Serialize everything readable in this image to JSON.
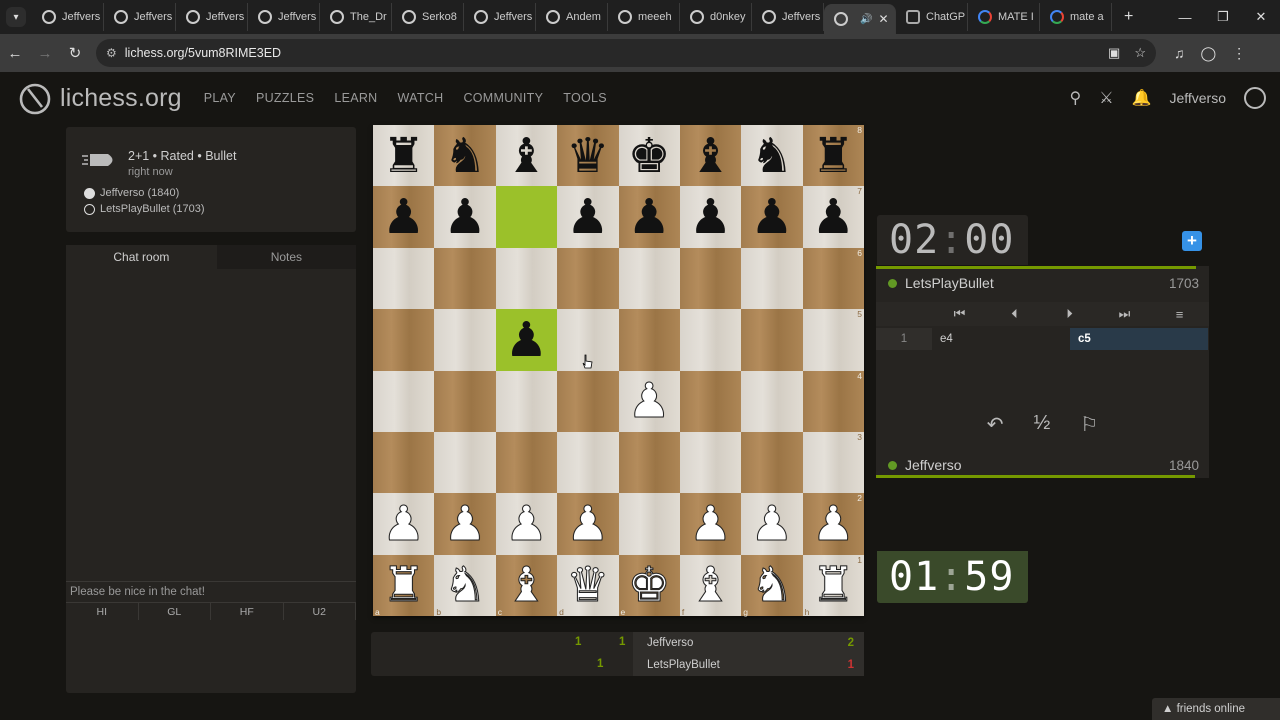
{
  "browser": {
    "tabs": [
      {
        "label": "Jeffvers",
        "icon": "lichess"
      },
      {
        "label": "Jeffvers",
        "icon": "lichess"
      },
      {
        "label": "Jeffvers",
        "icon": "lichess"
      },
      {
        "label": "Jeffvers",
        "icon": "lichess"
      },
      {
        "label": "The_Dr",
        "icon": "lichess"
      },
      {
        "label": "Serko8",
        "icon": "lichess"
      },
      {
        "label": "Jeffvers",
        "icon": "lichess"
      },
      {
        "label": "Andem",
        "icon": "lichess"
      },
      {
        "label": "meeeh",
        "icon": "lichess"
      },
      {
        "label": "d0nkey",
        "icon": "lichess"
      },
      {
        "label": "Jeffvers",
        "icon": "lichess"
      },
      {
        "label": "",
        "icon": "lichess",
        "active": true
      },
      {
        "label": "ChatGP",
        "icon": "chatgpt"
      },
      {
        "label": "MATE I",
        "icon": "google"
      },
      {
        "label": "mate a",
        "icon": "google"
      }
    ],
    "url": "lichess.org/5vum8RIME3ED"
  },
  "header": {
    "logo_text": "lichess.org",
    "nav": [
      "PLAY",
      "PUZZLES",
      "LEARN",
      "WATCH",
      "COMMUNITY",
      "TOOLS"
    ],
    "username": "Jeffverso"
  },
  "game_info": {
    "title": "2+1 • Rated • Bullet",
    "time": "right now",
    "white_player": "Jeffverso (1840)",
    "black_player": "LetsPlayBullet (1703)"
  },
  "chat": {
    "tab_chat": "Chat room",
    "tab_notes": "Notes",
    "placeholder": "Please be nice in the chat!",
    "presets": [
      "HI",
      "GL",
      "HF",
      "U2"
    ]
  },
  "board": {
    "ranks": [
      "8",
      "7",
      "6",
      "5",
      "4",
      "3",
      "2",
      "1"
    ],
    "files": [
      "a",
      "b",
      "c",
      "d",
      "e",
      "f",
      "g",
      "h"
    ],
    "position": [
      [
        "bR",
        "bN",
        "bB",
        "bQ",
        "bK",
        "bB",
        "bN",
        "bR"
      ],
      [
        "bP",
        "bP",
        "",
        "bP",
        "bP",
        "bP",
        "bP",
        "bP"
      ],
      [
        "",
        "",
        "",
        "",
        "",
        "",
        "",
        ""
      ],
      [
        "",
        "",
        "bP",
        "",
        "",
        "",
        "",
        ""
      ],
      [
        "",
        "",
        "",
        "",
        "wP",
        "",
        "",
        ""
      ],
      [
        "",
        "",
        "",
        "",
        "",
        "",
        "",
        ""
      ],
      [
        "wP",
        "wP",
        "wP",
        "wP",
        "",
        "wP",
        "wP",
        "wP"
      ],
      [
        "wR",
        "wN",
        "wB",
        "wQ",
        "wK",
        "wB",
        "wN",
        "wR"
      ]
    ],
    "highlight": [
      "c7",
      "c5"
    ]
  },
  "scores": [
    {
      "a": "1",
      "b": "1",
      "name": "Jeffverso",
      "total": "2",
      "total_color": "#759900"
    },
    {
      "a": "",
      "b": "1",
      "name": "LetsPlayBullet",
      "total": "1",
      "total_color": "#cc3333"
    }
  ],
  "clocks": {
    "top_min": "02",
    "top_sec": "00",
    "bottom_min": "01",
    "bottom_sec": "59"
  },
  "players": {
    "top_name": "LetsPlayBullet",
    "top_rating": "1703",
    "bottom_name": "Jeffverso",
    "bottom_rating": "1840"
  },
  "moves": {
    "number": "1",
    "white": "e4",
    "black": "c5"
  },
  "footer": {
    "friends": "friends online"
  },
  "colors": {
    "accent_green": "#759900",
    "highlight": "#9bc12a",
    "active_move": "#293a49",
    "plus_button": "#3692e7"
  }
}
